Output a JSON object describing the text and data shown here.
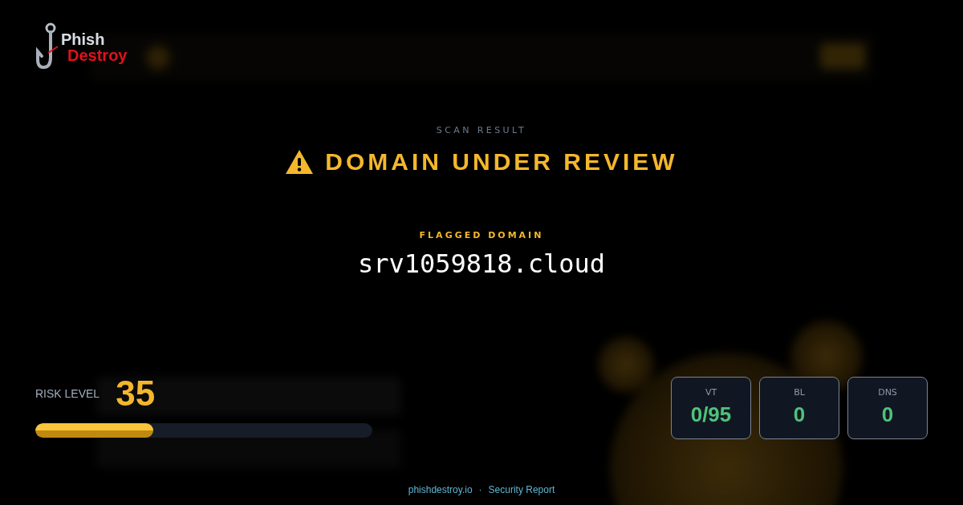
{
  "logo": {
    "line_1": "Phish",
    "line_2": "Destroy"
  },
  "header": {
    "eyebrow": "SCAN RESULT",
    "title": "DOMAIN UNDER REVIEW"
  },
  "domain": {
    "label": "FLAGGED DOMAIN",
    "value": "srv1059818.cloud"
  },
  "risk": {
    "label": "RISK LEVEL",
    "score": "35",
    "level": 0.35
  },
  "stats": [
    {
      "label": "VT",
      "value": "0/95"
    },
    {
      "label": "BL",
      "value": "0"
    },
    {
      "label": "DNS",
      "value": "0"
    }
  ],
  "footer": {
    "site": "phishdestroy.io",
    "separator": "·",
    "report": "Security Report"
  }
}
